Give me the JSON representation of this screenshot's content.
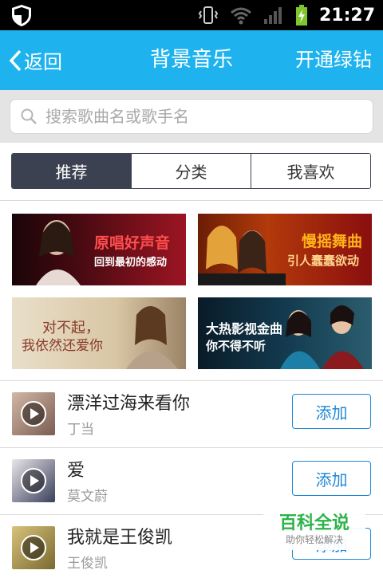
{
  "status_bar": {
    "time": "21:27"
  },
  "header": {
    "back_label": "返回",
    "title": "背景音乐",
    "right_action": "开通绿钻"
  },
  "search": {
    "placeholder": "搜索歌曲名或歌手名"
  },
  "tabs": [
    {
      "label": "推荐",
      "active": true
    },
    {
      "label": "分类",
      "active": false
    },
    {
      "label": "我喜欢",
      "active": false
    }
  ],
  "banners": [
    {
      "line1": "原唱好声音",
      "line2": "回到最初的感动"
    },
    {
      "line1": "慢摇舞曲",
      "line2": "引人蠢蠢欲动"
    },
    {
      "line1": "对不起，",
      "line2": "我依然还爱你"
    },
    {
      "line1": "大热影视金曲",
      "line2": "你不得不听"
    }
  ],
  "songs": [
    {
      "title": "漂洋过海来看你",
      "artist": "丁当",
      "action": "添加"
    },
    {
      "title": "爱",
      "artist": "莫文蔚",
      "action": "添加"
    },
    {
      "title": "我就是王俊凯",
      "artist": "王俊凯",
      "action": "添加"
    }
  ],
  "watermark": {
    "title": "百科全说",
    "subtitle": "助你轻松解决"
  },
  "colors": {
    "header_blue": "#1eb3ee",
    "tab_active": "#3b4150",
    "button_blue": "#1e88d8",
    "watermark_green": "#2eb34a"
  }
}
